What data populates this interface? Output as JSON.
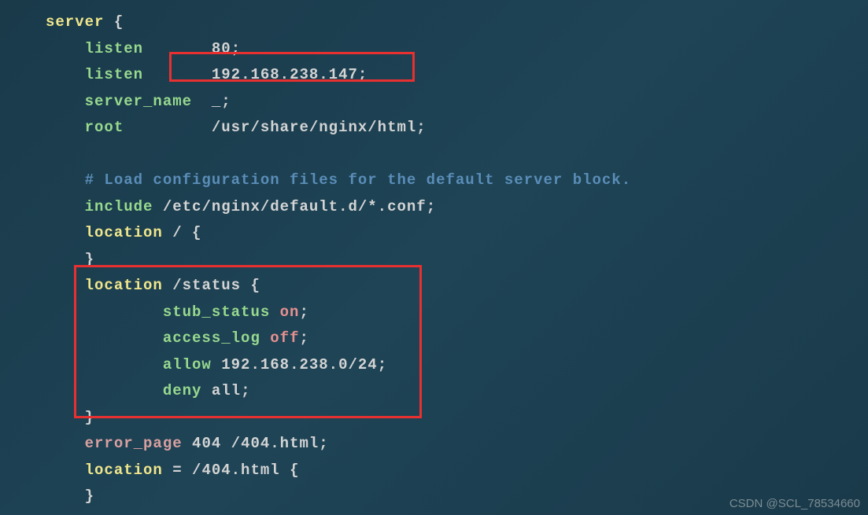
{
  "code": {
    "server_kw": "server",
    "open_brace": " {",
    "listen1_kw": "listen",
    "listen1_val": "80",
    "listen2_kw": "listen",
    "listen2_val": "192.168.238.147",
    "servername_kw": "server_name",
    "servername_val": "_",
    "root_kw": "root",
    "root_val": "/usr/share/nginx/html",
    "comment": "# Load configuration files for the default server block.",
    "include_kw": "include",
    "include_val": "/etc/nginx/default.d/*.conf",
    "location1_kw": "location",
    "location1_path": "/",
    "location2_kw": "location",
    "location2_path": "/status",
    "stub_kw": "stub_status",
    "stub_val": "on",
    "access_kw": "access_log",
    "access_val": "off",
    "allow_kw": "allow",
    "allow_val": "192.168.238.0/24",
    "deny_kw": "deny",
    "deny_val": "all",
    "error_kw": "error_page",
    "error_code": "404",
    "error_path": "/404.html",
    "location3_kw": "location",
    "location3_eq": "=",
    "location3_path": "/404.html",
    "semi": ";",
    "close_brace": "}",
    "open_brace2": "{"
  },
  "watermark": "CSDN @SCL_78534660"
}
